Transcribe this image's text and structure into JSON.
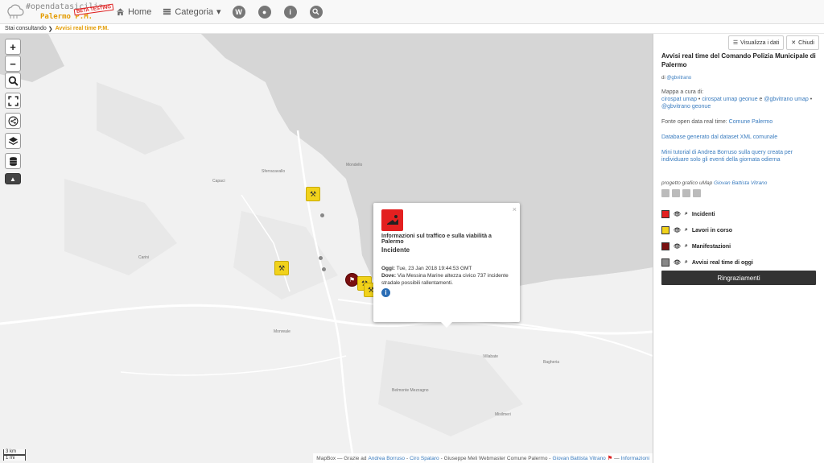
{
  "brand": {
    "line1": "#opendatasicilia",
    "line2": "Palermo",
    "line2_suffix": "P.M.",
    "badge": "BETA TESTING"
  },
  "nav": {
    "home": "Home",
    "categoria": "Categoria"
  },
  "breadcrumb": {
    "prefix": "Stai consultando",
    "current": "Avvisi real time P.M."
  },
  "map": {
    "scale_km": "3 km",
    "scale_mi": "1 mi",
    "attribution": {
      "prefix": "MapBox — Grazie ad",
      "names": [
        "Andrea Borruso",
        "Ciro Spataro"
      ],
      "middle": "- Giuseppe Meli Webmaster Comune Palermo -",
      "last": "Giovan Battista Vitrano",
      "info": "Informazioni"
    },
    "places": [
      "Capaci",
      "Carini",
      "Sferracavallo",
      "Mondello",
      "Monreale",
      "Villabate",
      "Bagheria",
      "Belmonte Mezzagno",
      "Misilmeri"
    ],
    "colors": {
      "incidenti": "#e32020",
      "lavori": "#f1d21b",
      "manifestazioni": "#7a1010",
      "oggi": "#888888"
    }
  },
  "popup": {
    "title": "Informazioni sul traffico e sulla viabilità a Palermo",
    "type": "Incidente",
    "oggi_label": "Oggi:",
    "oggi_value": "Tue, 23 Jan 2018 19:44:53 GMT",
    "dove_label": "Dove:",
    "dove_value": "Via Messina Marine altezza civico 737 incidente stradale possibili rallentamenti."
  },
  "sidebar": {
    "view_data_label": "Visualizza i dati",
    "close_label": "Chiudi",
    "title": "Avvisi real time del Comando Polizia Municipale di Palermo",
    "by_prefix": "di",
    "by_name": "@gbvitrano",
    "curated_by": "Mappa a cura di:",
    "authors": [
      "cirospat umap",
      "cirospat umap geonue",
      "@gbvitrano umap",
      "@gbvitrano geonue"
    ],
    "source_label": "Fonte open data real time:",
    "source_link": "Comune Palermo",
    "db_text": "Database generato dal dataset XML comunale",
    "tutorial_text": "Mini tutorial di Andrea Borruso sulla query creata per individuare solo gli eventi della giornata odierna",
    "credits_prefix": "progetto grafico uMap",
    "credits_name": "Giovan Battista Vitrano",
    "legend": [
      {
        "label": "Incidenti",
        "color": "#e32020"
      },
      {
        "label": "Lavori in corso",
        "color": "#f1d21b"
      },
      {
        "label": "Manifestazioni",
        "color": "#7a1010"
      },
      {
        "label": "Avvisi real time di oggi",
        "color": "#888888"
      }
    ],
    "thanks_label": "Ringraziamenti"
  }
}
